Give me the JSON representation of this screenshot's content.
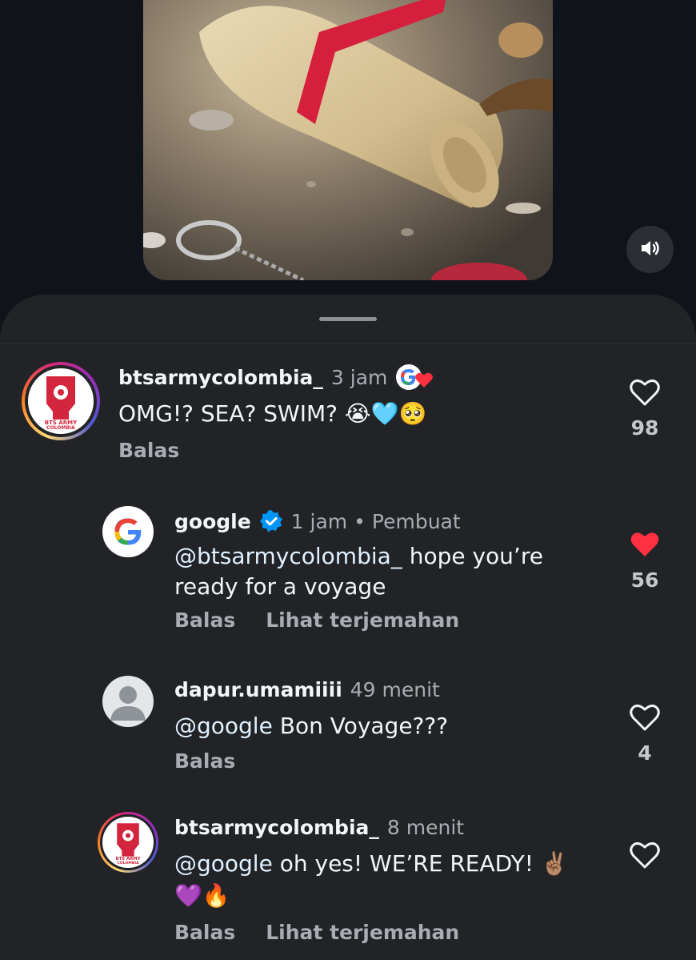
{
  "media": {
    "sound_icon": "speaker-icon"
  },
  "comments": [
    {
      "username": "btsarmycolombia_",
      "time": "3 jam",
      "text": "OMG!? SEA? SWIM? 😭🩵🥺",
      "actions": [
        "Balas"
      ],
      "likes": "98",
      "liked": false,
      "creator_liked": true,
      "avatar": {
        "logo_text": "BTS ARMY COLOMBIA"
      }
    },
    {
      "username": "google",
      "time": "1 jam",
      "tag": "Pembuat",
      "mention": "@btsarmycolombia_",
      "text": " hope you’re ready for a voyage",
      "actions": [
        "Balas",
        "Lihat terjemahan"
      ],
      "likes": "56",
      "liked": true,
      "verified": true
    },
    {
      "username": "dapur.umamiiii",
      "time": "49 menit",
      "mention": "@google",
      "text": " Bon Voyage???",
      "actions": [
        "Balas"
      ],
      "likes": "4",
      "liked": false
    },
    {
      "username": "btsarmycolombia_",
      "time": "8 menit",
      "mention": "@google",
      "text": " oh yes! WE’RE READY! ✌🏽",
      "text_line2": "💜🔥",
      "actions": [
        "Balas",
        "Lihat terjemahan"
      ],
      "likes": "",
      "liked": false,
      "avatar": {
        "logo_text": "BTS ARMY COLOMBIA"
      }
    }
  ],
  "colors": {
    "like_red": "#ff3040",
    "verified_blue": "#0095f6",
    "sheet_bg": "#212327"
  }
}
